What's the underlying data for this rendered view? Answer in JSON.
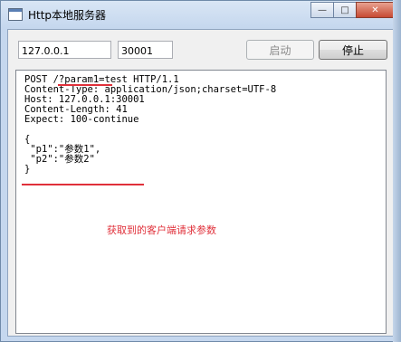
{
  "window": {
    "title": "Http本地服务器",
    "min_label": "—",
    "max_label": "□",
    "close_label": "✕"
  },
  "form": {
    "ip_value": "127.0.0.1",
    "port_value": "30001",
    "start_label": "启动",
    "stop_label": "停止"
  },
  "request_lines": [
    "POST /?param1=test HTTP/1.1",
    "Content-Type: application/json;charset=UTF-8",
    "Host: 127.0.0.1:30001",
    "Content-Length: 41",
    "Expect: 100-continue",
    "",
    "{",
    " \"p1\":\"参数1\",",
    " \"p2\":\"参数2\"",
    "}"
  ],
  "annotation": "获取到的客户端请求参数",
  "colors": {
    "annotation": "#e0303a"
  }
}
